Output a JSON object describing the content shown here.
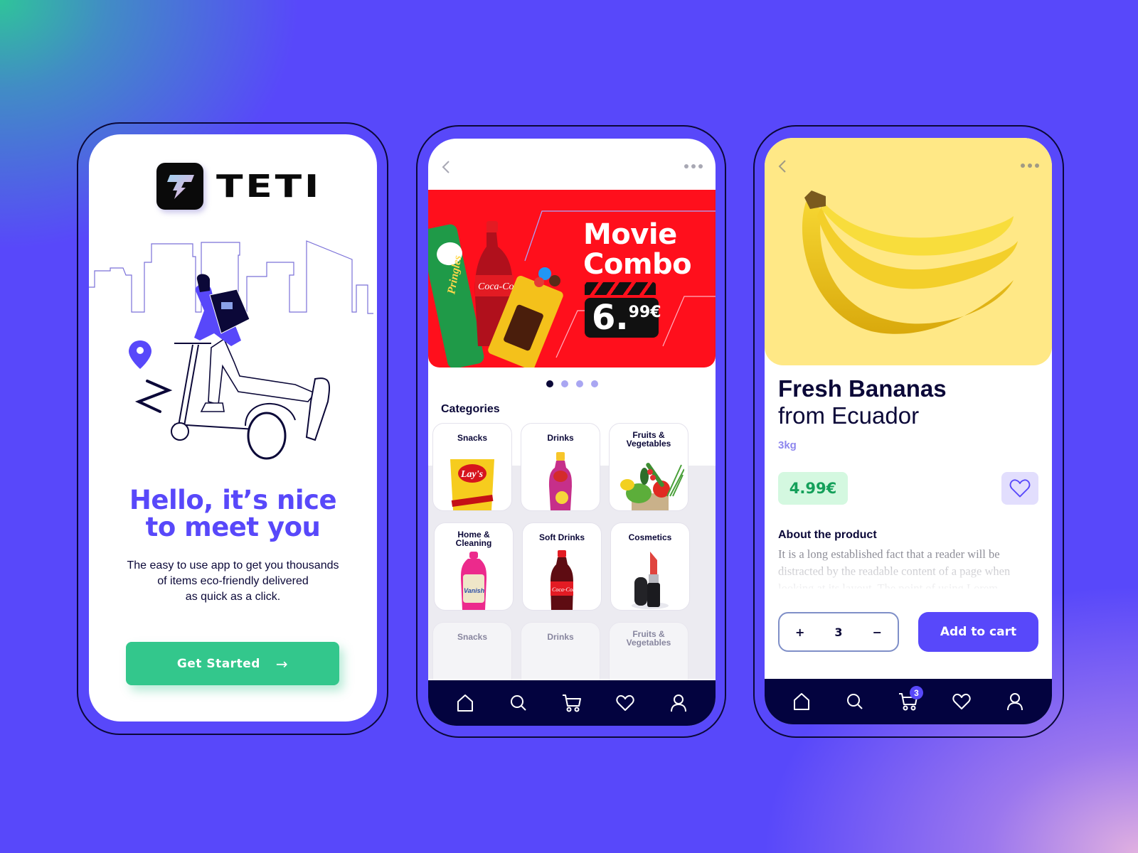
{
  "colors": {
    "background": "#5848fa",
    "accent": "#5848fa",
    "navy": "#0b0838",
    "green": "#33c78c",
    "banner_red": "#ff0f1c",
    "hero_yellow": "#ffe886"
  },
  "welcome": {
    "brand": "TETI",
    "headline_line1": "Hello, it’s nice",
    "headline_line2": "to meet you",
    "subtitle_line1": "The easy to use app to get you thousands",
    "subtitle_line2": "of items eco-friendly delivered",
    "subtitle_line3": "as quick as a click.",
    "cta_label": "Get Started",
    "cta_icon": "arrow-right-icon"
  },
  "home": {
    "banner": {
      "title_line1": "Movie",
      "title_line2": "Combo",
      "price_whole": "6.",
      "price_fraction": "99€"
    },
    "carousel": {
      "total": 4,
      "active": 1
    },
    "categories_heading": "Categories",
    "categories": [
      {
        "label": "Snacks"
      },
      {
        "label": "Drinks"
      },
      {
        "label": "Fruits & Vegetables",
        "line1": "Fruits &",
        "line2": "Vegetables"
      },
      {
        "label": "Home & Cleaning",
        "line1": "Home &",
        "line2": "Cleaning"
      },
      {
        "label": "Soft Drinks"
      },
      {
        "label": "Cosmetics"
      },
      {
        "label": "Snacks"
      },
      {
        "label": "Drinks"
      },
      {
        "label": "Fruits & Vegetables",
        "line1": "Fruits &",
        "line2": "Vegetables"
      }
    ]
  },
  "nav": {
    "items": [
      "home",
      "search",
      "cart",
      "favorites",
      "profile"
    ],
    "cart_badge": "3"
  },
  "product": {
    "title_bold": "Fresh Bananas",
    "title_light": "from Ecuador",
    "weight": "3kg",
    "price": "4.99€",
    "about_heading": "About the product",
    "about_text": "It is a long established fact that a reader will be distracted by the readable content of a page when looking at its layout. The point of using Lorem",
    "quantity": "3",
    "plus_label": "+",
    "minus_label": "−",
    "add_to_cart_label": "Add to cart"
  }
}
